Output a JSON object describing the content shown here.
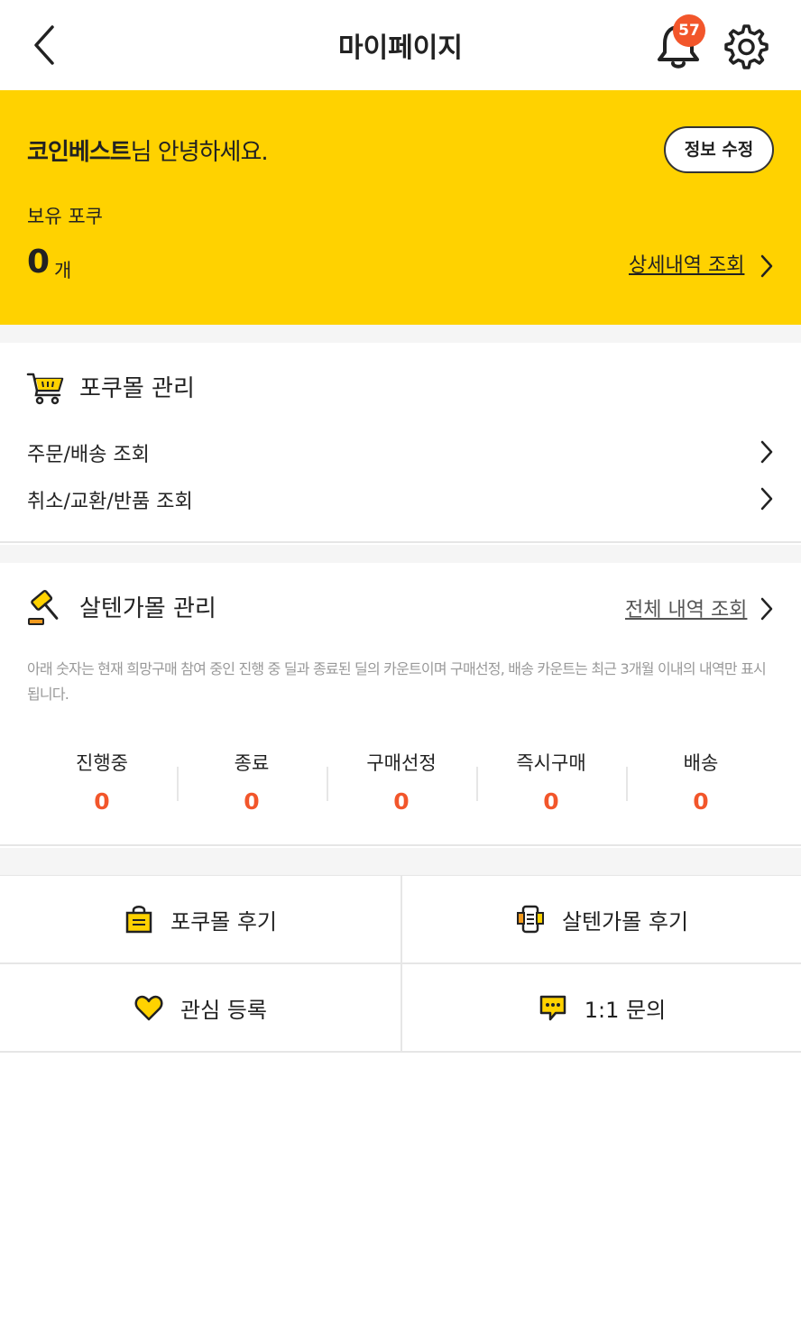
{
  "header": {
    "title": "마이페이지",
    "notification_count": "57"
  },
  "hero": {
    "user_name": "코인베스트",
    "greeting_suffix": "님 안녕하세요.",
    "edit_label": "정보 수정",
    "points_label": "보유 포쿠",
    "points_value": "0",
    "points_unit": "개",
    "detail_link": "상세내역 조회"
  },
  "pokumall": {
    "title": "포쿠몰 관리",
    "items": [
      {
        "label": "주문/배송 조회"
      },
      {
        "label": "취소/교환/반품 조회"
      }
    ]
  },
  "saltenga": {
    "title": "살텐가몰 관리",
    "all_link": "전체 내역 조회",
    "note": "아래 숫자는 현재 희망구매 참여 중인 진행 중 딜과 종료된 딜의 카운트이며 구매선정, 배송 카운트는 최근 3개월 이내의 내역만 표시됩니다.",
    "stats": [
      {
        "label": "진행중",
        "value": "0"
      },
      {
        "label": "종료",
        "value": "0"
      },
      {
        "label": "구매선정",
        "value": "0"
      },
      {
        "label": "즉시구매",
        "value": "0"
      },
      {
        "label": "배송",
        "value": "0"
      }
    ]
  },
  "grid": {
    "items": [
      {
        "label": "포쿠몰 후기",
        "icon": "shopping-bag-icon"
      },
      {
        "label": "살텐가몰 후기",
        "icon": "phone-review-icon"
      },
      {
        "label": "관심 등록",
        "icon": "heart-icon"
      },
      {
        "label": "1:1 문의",
        "icon": "chat-bubble-icon"
      }
    ]
  },
  "colors": {
    "accent_yellow": "#ffd200",
    "count_orange": "#f2562b"
  }
}
